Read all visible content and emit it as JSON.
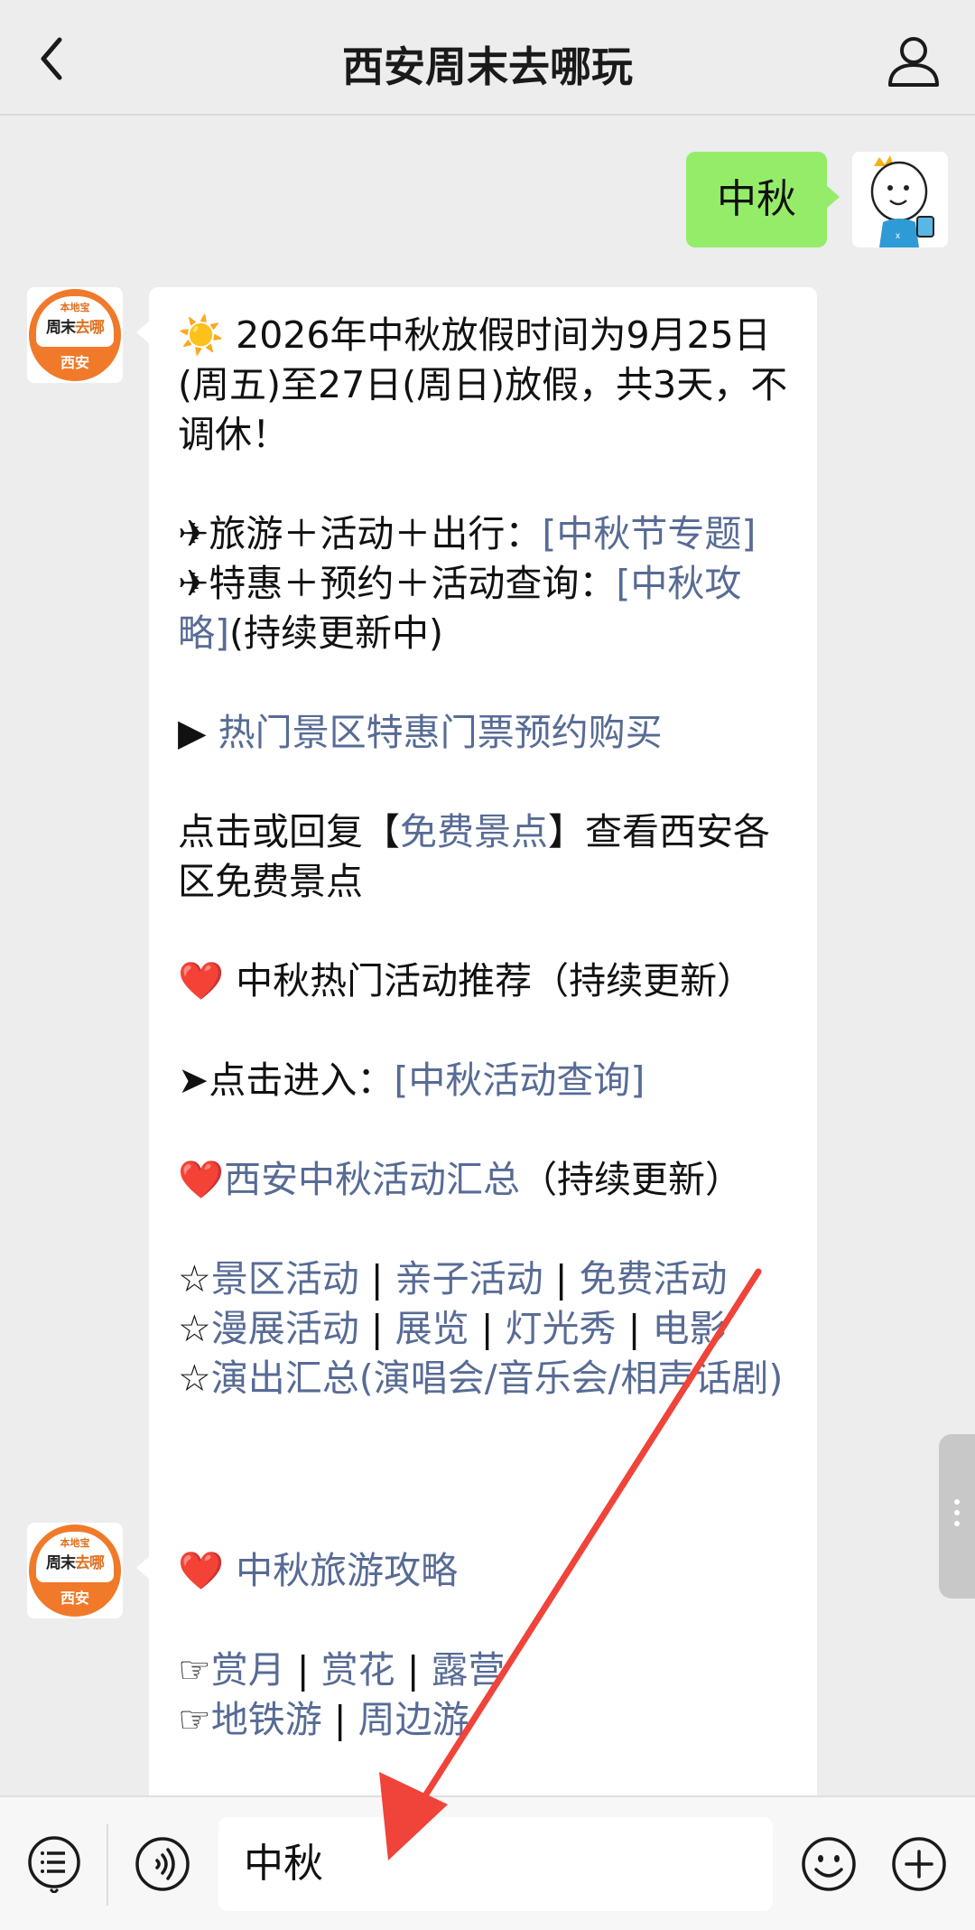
{
  "nav": {
    "title": "西安周末去哪玩"
  },
  "user_message": {
    "text": "中秋"
  },
  "official_account": {
    "logo_top": "本地宝",
    "logo_main_a": "周末",
    "logo_main_b": "去哪",
    "logo_city": "西安"
  },
  "reply1": {
    "l1_icon": "☀️",
    "l1": "2026年中秋放假时间为9月25日(周五)至27日(周日)放假，共3天，不调休！",
    "l2_prefix": "✈旅游＋活动＋出行：",
    "l2_link": "[中秋节专题]",
    "l3_prefix": "✈特惠＋预约＋活动查询：",
    "l3_link": "[中秋攻略]",
    "l3_suffix": "(持续更新中)",
    "l4_prefix": "▶ ",
    "l4_link": "热门景区特惠门票预约购买",
    "l5_a": "点击或回复【",
    "l5_link": "免费景点",
    "l5_b": "】查看西安各区免费景点",
    "l6_icon": "❤️",
    "l6": " 中秋热门活动推荐（持续更新）",
    "l7_prefix": "➤点击进入：",
    "l7_link": "[中秋活动查询]",
    "l8_icon": "❤️",
    "l8_link": "西安中秋活动汇总",
    "l8_suffix": "（持续更新）",
    "star": "☆",
    "sep": " | ",
    "row1": [
      "景区活动",
      "亲子活动",
      "免费活动"
    ],
    "row2": [
      "漫展活动",
      "展览",
      "灯光秀",
      "电影"
    ],
    "row3": "演出汇总(演唱会/音乐会/相声话剧)"
  },
  "reply2": {
    "l1_icon": "❤️",
    "l1_link": "中秋旅游攻略",
    "hand": "☞",
    "sep": " | ",
    "row1": [
      "赏月",
      "赏花",
      "露营"
    ],
    "row2": [
      "地铁游",
      "周边游"
    ]
  },
  "input": {
    "value": "中秋"
  },
  "icons": {
    "back": "chevron-left-icon",
    "user": "person-icon",
    "menu": "list-menu-icon",
    "voice": "voice-icon",
    "emoji": "emoji-icon",
    "plus": "plus-icon"
  },
  "colors": {
    "link": "#576b95",
    "my_bubble": "#95ec69",
    "annotation_arrow": "#f0433a"
  }
}
